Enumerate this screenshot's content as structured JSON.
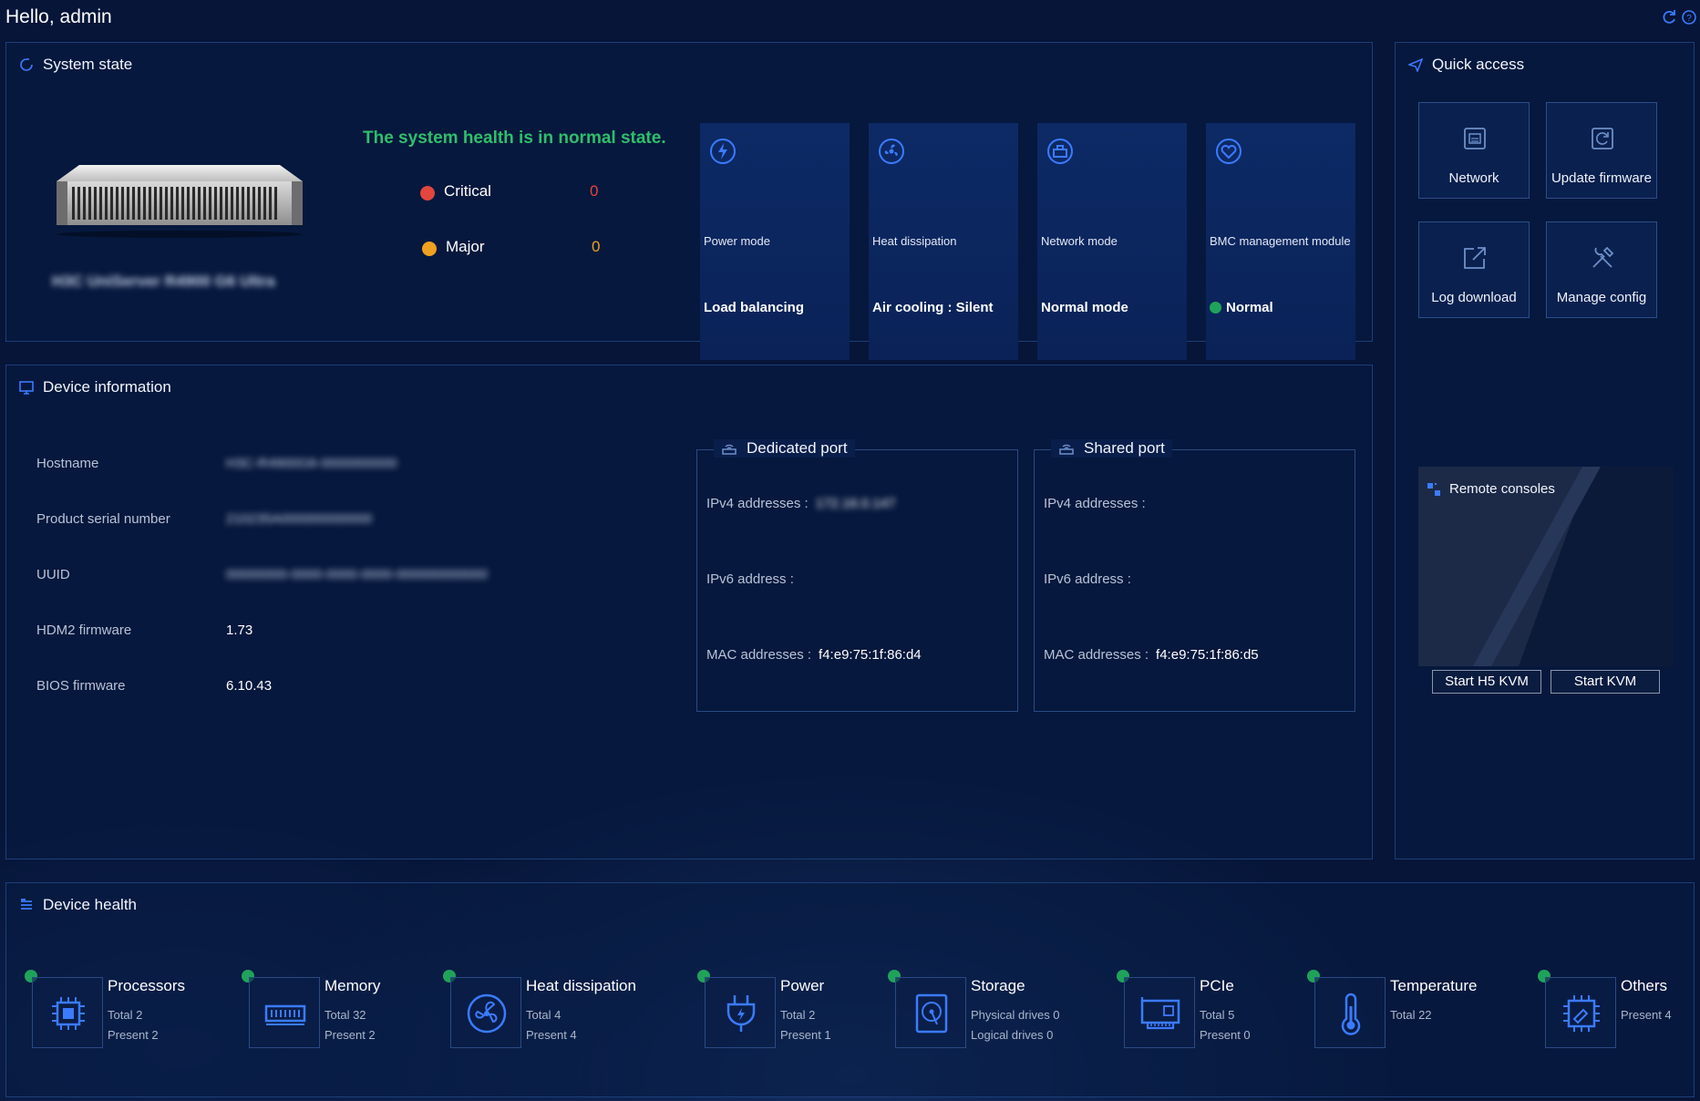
{
  "header": {
    "greeting": "Hello, admin"
  },
  "system_state": {
    "title": "System state",
    "model_name": "H3C UniServer R4900 G6 Ultra",
    "health_message": "The system health is in normal state.",
    "alarms": [
      {
        "label": "Critical",
        "count": "0",
        "color": "#e2463f"
      },
      {
        "label": "Major",
        "count": "0",
        "color": "#f0a020"
      }
    ],
    "tiles": [
      {
        "icon": "power-mode-icon",
        "label": "Power mode",
        "value": "Load balancing"
      },
      {
        "icon": "heat-dissipation-icon",
        "label": "Heat dissipation",
        "value": "Air cooling : Silent"
      },
      {
        "icon": "network-mode-icon",
        "label": "Network mode",
        "value": "Normal mode"
      },
      {
        "icon": "bmc-module-icon",
        "label": "BMC management module",
        "value": "Normal"
      }
    ]
  },
  "quick_access": {
    "title": "Quick access",
    "items": [
      {
        "label": "Network",
        "icon": "network-icon"
      },
      {
        "label": "Update firmware",
        "icon": "update-firmware-icon"
      },
      {
        "label": "Log download",
        "icon": "log-download-icon"
      },
      {
        "label": "Manage config",
        "icon": "manage-config-icon"
      }
    ],
    "remote": {
      "title": "Remote consoles",
      "h5_kvm": "Start H5 KVM",
      "kvm": "Start KVM"
    }
  },
  "device_info": {
    "title": "Device information",
    "rows": [
      {
        "label": "Hostname",
        "value": "H3C-R4900G6-0000000000"
      },
      {
        "label": "Product serial number",
        "value": "210235A000000000000"
      },
      {
        "label": "UUID",
        "value": "00000000-0000-0000-0000-000000000000"
      },
      {
        "label": "HDM2 firmware",
        "value": "1.73"
      },
      {
        "label": "BIOS firmware",
        "value": "6.10.43"
      }
    ],
    "dedicated": {
      "title": "Dedicated port",
      "ipv4_label": "IPv4 addresses :",
      "ipv4": "172.16.0.147",
      "ipv6_label": "IPv6 address :",
      "mac_label": "MAC addresses :",
      "mac": "f4:e9:75:1f:86:d4"
    },
    "shared": {
      "title": "Shared port",
      "ipv4_label": "IPv4 addresses :",
      "ipv6_label": "IPv6 address :",
      "mac_label": "MAC addresses :",
      "mac": "f4:e9:75:1f:86:d5"
    }
  },
  "device_health": {
    "title": "Device health",
    "items": [
      {
        "name": "Processors",
        "line1": "Total 2",
        "line2": "Present 2",
        "icon": "processor-icon"
      },
      {
        "name": "Memory",
        "line1": "Total 32",
        "line2": "Present 2",
        "icon": "memory-icon"
      },
      {
        "name": "Heat dissipation",
        "line1": "Total 4",
        "line2": "Present 4",
        "icon": "fan-icon"
      },
      {
        "name": "Power",
        "line1": "Total 2",
        "line2": "Present 1",
        "icon": "power-plug-icon"
      },
      {
        "name": "Storage",
        "line1": "Physical drives 0",
        "line2": "Logical drives 0",
        "icon": "storage-icon"
      },
      {
        "name": "PCIe",
        "line1": "Total 5",
        "line2": "Present 0",
        "icon": "pcie-icon"
      },
      {
        "name": "Temperature",
        "line1": "Total 22",
        "line2": "",
        "icon": "thermometer-icon"
      },
      {
        "name": "Others",
        "line1": "Present 4",
        "line2": "",
        "icon": "others-icon"
      }
    ]
  },
  "colors": {
    "accent": "#3b7bff",
    "ok": "#1fa35a",
    "health_text": "#2fbf6a"
  }
}
